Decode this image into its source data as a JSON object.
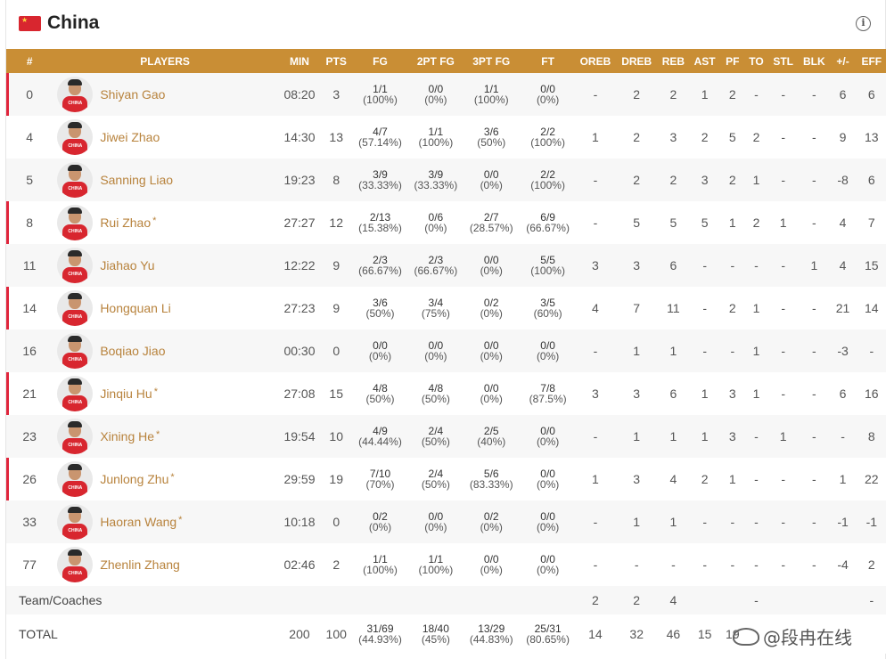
{
  "team": {
    "name": "China",
    "info_icon": "info-icon",
    "flag_icon": "china-flag-icon",
    "flag_color": "#d8262f"
  },
  "accent": "#c98e35",
  "starter_color": "#e0253c",
  "columns": [
    "#",
    "PLAYERS",
    "MIN",
    "PTS",
    "FG",
    "2PT FG",
    "3PT FG",
    "FT",
    "OREB",
    "DREB",
    "REB",
    "AST",
    "PF",
    "TO",
    "STL",
    "BLK",
    "+/-",
    "EFF"
  ],
  "players": [
    {
      "num": "0",
      "name": "Shiyan Gao",
      "star": "",
      "starter": true,
      "min": "08:20",
      "pts": "3",
      "fg": [
        "1/1",
        "(100%)"
      ],
      "fg2": [
        "0/0",
        "(0%)"
      ],
      "fg3": [
        "1/1",
        "(100%)"
      ],
      "ft": [
        "0/0",
        "(0%)"
      ],
      "oreb": "-",
      "dreb": "2",
      "reb": "2",
      "ast": "1",
      "pf": "2",
      "to": "-",
      "stl": "-",
      "blk": "-",
      "pm": "6",
      "eff": "6"
    },
    {
      "num": "4",
      "name": "Jiwei Zhao",
      "star": "",
      "starter": false,
      "min": "14:30",
      "pts": "13",
      "fg": [
        "4/7",
        "(57.14%)"
      ],
      "fg2": [
        "1/1",
        "(100%)"
      ],
      "fg3": [
        "3/6",
        "(50%)"
      ],
      "ft": [
        "2/2",
        "(100%)"
      ],
      "oreb": "1",
      "dreb": "2",
      "reb": "3",
      "ast": "2",
      "pf": "5",
      "to": "2",
      "stl": "-",
      "blk": "-",
      "pm": "9",
      "eff": "13"
    },
    {
      "num": "5",
      "name": "Sanning Liao",
      "star": "",
      "starter": false,
      "min": "19:23",
      "pts": "8",
      "fg": [
        "3/9",
        "(33.33%)"
      ],
      "fg2": [
        "3/9",
        "(33.33%)"
      ],
      "fg3": [
        "0/0",
        "(0%)"
      ],
      "ft": [
        "2/2",
        "(100%)"
      ],
      "oreb": "-",
      "dreb": "2",
      "reb": "2",
      "ast": "3",
      "pf": "2",
      "to": "1",
      "stl": "-",
      "blk": "-",
      "pm": "-8",
      "eff": "6"
    },
    {
      "num": "8",
      "name": "Rui Zhao",
      "star": "*",
      "starter": true,
      "min": "27:27",
      "pts": "12",
      "fg": [
        "2/13",
        "(15.38%)"
      ],
      "fg2": [
        "0/6",
        "(0%)"
      ],
      "fg3": [
        "2/7",
        "(28.57%)"
      ],
      "ft": [
        "6/9",
        "(66.67%)"
      ],
      "oreb": "-",
      "dreb": "5",
      "reb": "5",
      "ast": "5",
      "pf": "1",
      "to": "2",
      "stl": "1",
      "blk": "-",
      "pm": "4",
      "eff": "7"
    },
    {
      "num": "11",
      "name": "Jiahao Yu",
      "star": "",
      "starter": false,
      "min": "12:22",
      "pts": "9",
      "fg": [
        "2/3",
        "(66.67%)"
      ],
      "fg2": [
        "2/3",
        "(66.67%)"
      ],
      "fg3": [
        "0/0",
        "(0%)"
      ],
      "ft": [
        "5/5",
        "(100%)"
      ],
      "oreb": "3",
      "dreb": "3",
      "reb": "6",
      "ast": "-",
      "pf": "-",
      "to": "-",
      "stl": "-",
      "blk": "1",
      "pm": "4",
      "eff": "15"
    },
    {
      "num": "14",
      "name": "Hongquan Li",
      "star": "",
      "starter": true,
      "min": "27:23",
      "pts": "9",
      "fg": [
        "3/6",
        "(50%)"
      ],
      "fg2": [
        "3/4",
        "(75%)"
      ],
      "fg3": [
        "0/2",
        "(0%)"
      ],
      "ft": [
        "3/5",
        "(60%)"
      ],
      "oreb": "4",
      "dreb": "7",
      "reb": "11",
      "ast": "-",
      "pf": "2",
      "to": "1",
      "stl": "-",
      "blk": "-",
      "pm": "21",
      "eff": "14"
    },
    {
      "num": "16",
      "name": "Boqiao Jiao",
      "star": "",
      "starter": false,
      "min": "00:30",
      "pts": "0",
      "fg": [
        "0/0",
        "(0%)"
      ],
      "fg2": [
        "0/0",
        "(0%)"
      ],
      "fg3": [
        "0/0",
        "(0%)"
      ],
      "ft": [
        "0/0",
        "(0%)"
      ],
      "oreb": "-",
      "dreb": "1",
      "reb": "1",
      "ast": "-",
      "pf": "-",
      "to": "1",
      "stl": "-",
      "blk": "-",
      "pm": "-3",
      "eff": "-"
    },
    {
      "num": "21",
      "name": "Jinqiu Hu",
      "star": "*",
      "starter": true,
      "min": "27:08",
      "pts": "15",
      "fg": [
        "4/8",
        "(50%)"
      ],
      "fg2": [
        "4/8",
        "(50%)"
      ],
      "fg3": [
        "0/0",
        "(0%)"
      ],
      "ft": [
        "7/8",
        "(87.5%)"
      ],
      "oreb": "3",
      "dreb": "3",
      "reb": "6",
      "ast": "1",
      "pf": "3",
      "to": "1",
      "stl": "-",
      "blk": "-",
      "pm": "6",
      "eff": "16"
    },
    {
      "num": "23",
      "name": "Xining He",
      "star": "*",
      "starter": false,
      "min": "19:54",
      "pts": "10",
      "fg": [
        "4/9",
        "(44.44%)"
      ],
      "fg2": [
        "2/4",
        "(50%)"
      ],
      "fg3": [
        "2/5",
        "(40%)"
      ],
      "ft": [
        "0/0",
        "(0%)"
      ],
      "oreb": "-",
      "dreb": "1",
      "reb": "1",
      "ast": "1",
      "pf": "3",
      "to": "-",
      "stl": "1",
      "blk": "-",
      "pm": "-",
      "eff": "8"
    },
    {
      "num": "26",
      "name": "Junlong Zhu",
      "star": "*",
      "starter": true,
      "min": "29:59",
      "pts": "19",
      "fg": [
        "7/10",
        "(70%)"
      ],
      "fg2": [
        "2/4",
        "(50%)"
      ],
      "fg3": [
        "5/6",
        "(83.33%)"
      ],
      "ft": [
        "0/0",
        "(0%)"
      ],
      "oreb": "1",
      "dreb": "3",
      "reb": "4",
      "ast": "2",
      "pf": "1",
      "to": "-",
      "stl": "-",
      "blk": "-",
      "pm": "1",
      "eff": "22"
    },
    {
      "num": "33",
      "name": "Haoran Wang",
      "star": "*",
      "starter": false,
      "min": "10:18",
      "pts": "0",
      "fg": [
        "0/2",
        "(0%)"
      ],
      "fg2": [
        "0/0",
        "(0%)"
      ],
      "fg3": [
        "0/2",
        "(0%)"
      ],
      "ft": [
        "0/0",
        "(0%)"
      ],
      "oreb": "-",
      "dreb": "1",
      "reb": "1",
      "ast": "-",
      "pf": "-",
      "to": "-",
      "stl": "-",
      "blk": "-",
      "pm": "-1",
      "eff": "-1"
    },
    {
      "num": "77",
      "name": "Zhenlin Zhang",
      "star": "",
      "starter": false,
      "min": "02:46",
      "pts": "2",
      "fg": [
        "1/1",
        "(100%)"
      ],
      "fg2": [
        "1/1",
        "(100%)"
      ],
      "fg3": [
        "0/0",
        "(0%)"
      ],
      "ft": [
        "0/0",
        "(0%)"
      ],
      "oreb": "-",
      "dreb": "-",
      "reb": "-",
      "ast": "-",
      "pf": "-",
      "to": "-",
      "stl": "-",
      "blk": "-",
      "pm": "-4",
      "eff": "2"
    }
  ],
  "team_row": {
    "label": "Team/Coaches",
    "oreb": "2",
    "dreb": "2",
    "reb": "4",
    "ast": "",
    "pf": "",
    "to": "-",
    "stl": "",
    "blk": "",
    "pm": "",
    "eff": "-"
  },
  "total_row": {
    "label": "TOTAL",
    "min": "200",
    "pts": "100",
    "fg": [
      "31/69",
      "(44.93%)"
    ],
    "fg2": [
      "18/40",
      "(45%)"
    ],
    "fg3": [
      "13/29",
      "(44.83%)"
    ],
    "ft": [
      "25/31",
      "(80.65%)"
    ],
    "oreb": "14",
    "dreb": "32",
    "reb": "46",
    "ast": "15",
    "pf": "19"
  },
  "watermark": {
    "text": "@段冉在线",
    "icon": "weibo-icon"
  }
}
